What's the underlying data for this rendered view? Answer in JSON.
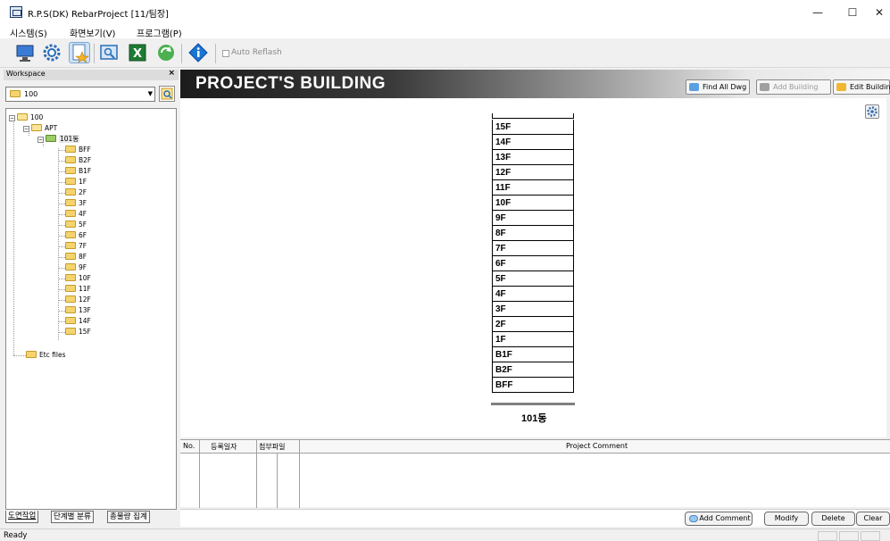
{
  "window": {
    "title": "R.P.S(DK) RebarProject [11/팀장]",
    "minimize": "—",
    "maximize": "☐",
    "close": "✕"
  },
  "menu": [
    "시스템(S)",
    "화면보기(V)",
    "프로그램(P)"
  ],
  "toolbar": {
    "auto_reflash_label": "Auto Reflash",
    "auto_reflash_checked": false,
    "icons": [
      "monitor-icon",
      "settings-gear-icon",
      "star-document-icon",
      "preview-icon",
      "excel-icon",
      "refresh-icon",
      "info-icon"
    ]
  },
  "workspace": {
    "title": "Workspace",
    "close": "×",
    "selected_project": "100",
    "tree": {
      "root": "100",
      "group": "APT",
      "building": "101동",
      "floors": [
        "BFF",
        "B2F",
        "B1F",
        "1F",
        "2F",
        "3F",
        "4F",
        "5F",
        "6F",
        "7F",
        "8F",
        "9F",
        "10F",
        "11F",
        "12F",
        "13F",
        "14F",
        "15F"
      ],
      "etc": "Etc files"
    },
    "tabs": [
      "도면작업",
      "단계별 분류",
      "총물량 집계"
    ]
  },
  "main": {
    "banner_title": "PROJECT'S BUILDING",
    "buttons": {
      "find_all": "Find All Dwg",
      "add_building": "Add Building",
      "edit_building": "Edit Building"
    },
    "building": {
      "name": "101동",
      "floors_top_down": [
        "15F",
        "14F",
        "13F",
        "12F",
        "11F",
        "10F",
        "9F",
        "8F",
        "7F",
        "6F",
        "5F",
        "4F",
        "3F",
        "2F",
        "1F",
        "B1F",
        "B2F",
        "BFF"
      ]
    }
  },
  "comments": {
    "headers": {
      "no": "No.",
      "date": "등록일자",
      "attach": "첨부파일",
      "comment": "Project Comment"
    },
    "buttons": {
      "add": "Add Comment",
      "modify": "Modify",
      "delete": "Delete",
      "clear": "Clear"
    }
  },
  "status": "Ready",
  "colors": {
    "folder": "#f5d46e",
    "banner_dark": "#1c1c1c",
    "excel_green": "#1e7b34",
    "info_blue": "#1976d2"
  }
}
